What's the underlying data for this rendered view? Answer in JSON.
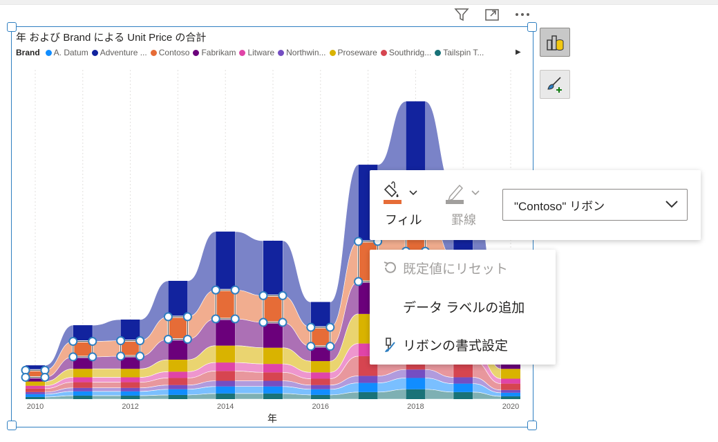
{
  "header_icons": [
    "filter-icon",
    "focus-mode-icon",
    "more-options-icon"
  ],
  "visual": {
    "title": "年 および Brand による Unit Price の合計",
    "legend_label": "Brand",
    "legend": [
      {
        "name": "A. Datum",
        "color": "#118DFF"
      },
      {
        "name": "Adventure ...",
        "color": "#12239E"
      },
      {
        "name": "Contoso",
        "color": "#E66C37"
      },
      {
        "name": "Fabrikam",
        "color": "#6B007B"
      },
      {
        "name": "Litware",
        "color": "#E044A7"
      },
      {
        "name": "Northwin...",
        "color": "#744EC2"
      },
      {
        "name": "Proseware",
        "color": "#D9B300"
      },
      {
        "name": "Southridg...",
        "color": "#D64550"
      },
      {
        "name": "Tailspin T...",
        "color": "#197278"
      }
    ],
    "xlabel": "年"
  },
  "chart_data": {
    "type": "area",
    "title": "年 および Brand による Unit Price の合計",
    "xlabel": "年",
    "ylabel": "",
    "x": [
      2010,
      2011,
      2012,
      2013,
      2014,
      2015,
      2016,
      2017,
      2018,
      2019,
      2020
    ],
    "x_ticks": [
      "2010",
      "2012",
      "2014",
      "2016",
      "2018",
      "2020"
    ],
    "ylim": [
      0,
      450
    ],
    "grid": false,
    "legend_position": "top",
    "series": [
      {
        "name": "Tailspin T...",
        "values": [
          3,
          5,
          5,
          6,
          8,
          8,
          6,
          10,
          14,
          10,
          4
        ]
      },
      {
        "name": "A. Datum",
        "values": [
          4,
          6,
          6,
          8,
          10,
          10,
          8,
          13,
          16,
          12,
          5
        ]
      },
      {
        "name": "Northwin...",
        "values": [
          3,
          5,
          5,
          6,
          8,
          8,
          6,
          10,
          12,
          9,
          4
        ]
      },
      {
        "name": "Southridg...",
        "values": [
          5,
          8,
          8,
          10,
          14,
          12,
          9,
          28,
          34,
          24,
          9
        ]
      },
      {
        "name": "Litware",
        "values": [
          4,
          7,
          7,
          9,
          12,
          12,
          9,
          18,
          26,
          18,
          7
        ]
      },
      {
        "name": "Proseware",
        "values": [
          6,
          12,
          12,
          17,
          24,
          23,
          16,
          42,
          52,
          38,
          14
        ]
      },
      {
        "name": "Fabrikam",
        "values": [
          6,
          17,
          18,
          29,
          38,
          36,
          21,
          46,
          56,
          40,
          15
        ]
      },
      {
        "name": "Contoso",
        "values": [
          10,
          22,
          22,
          32,
          41,
          38,
          27,
          57,
          70,
          50,
          18
        ]
      },
      {
        "name": "Adventure ...",
        "values": [
          7,
          23,
          30,
          51,
          83,
          78,
          36,
          109,
          143,
          100,
          38
        ]
      }
    ]
  },
  "format_panel": {
    "fill_label": "フィル",
    "border_label": "罫線",
    "fill_color": "#E66C37",
    "ribbon_select": "\"Contoso\" リボン"
  },
  "context_menu": {
    "items": [
      {
        "label": "既定値にリセット",
        "icon": "reset-icon",
        "disabled": true
      },
      {
        "label": "データ ラベルの追加",
        "icon": "",
        "disabled": false
      },
      {
        "label": "リボンの書式設定",
        "icon": "format-ribbon-icon",
        "disabled": false
      }
    ]
  }
}
